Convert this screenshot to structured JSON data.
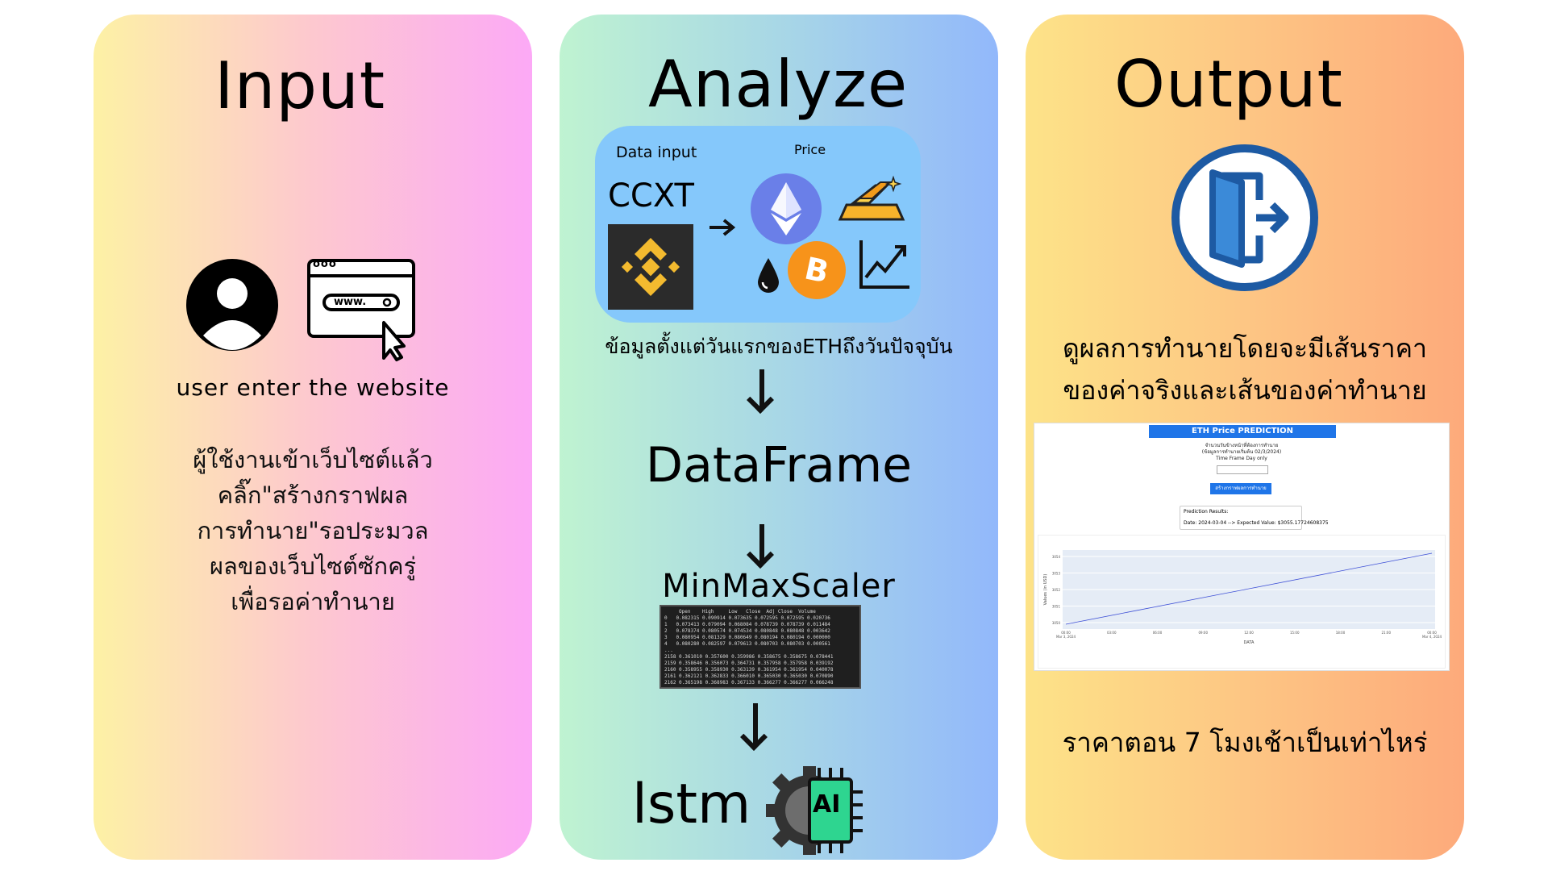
{
  "input": {
    "title": "Input",
    "caption": "user enter the website",
    "url_text": "www.",
    "browser_dots": "ooo",
    "thai_lines": [
      "ผู้ใช้งานเข้าเว็บไซต์แล้ว",
      "คลิ๊ก\"สร้างกราฟผล",
      "การทำนาย\"รอประมวล",
      "ผลของเว็บไซต์ซักครู่",
      "เพื่อรอค่าทำนาย"
    ]
  },
  "analyze": {
    "title": "Analyze",
    "data_input_label": "Data input",
    "price_label": "Price",
    "ccxt_label": "CCXT",
    "thai_caption": "ข้อมูลตั้งแต่วันแรกของETHถึงวันปัจจุบัน",
    "dataframe_label": "DataFrame",
    "scaler_label": "MinMaxScaler",
    "lstm_label": "lstm",
    "ai_label": "AI",
    "table_header": "     Open    High     Low   Close  Adj Close  Volume",
    "table_rows": [
      "0   0.082315 0.090914 0.073635 0.072595 0.072595 0.020736",
      "1   0.073413 0.079094 0.068084 0.078739 0.078739 0.011484",
      "2   0.078374 0.080574 0.074534 0.080848 0.080848 0.003642",
      "3   0.080954 0.081329 0.080649 0.080194 0.080194 0.000000",
      "4   0.080280 0.082597 0.079613 0.080703 0.080703 0.000561",
      "...",
      "2158 0.361010 0.357600 0.359986 0.358675 0.358675 0.078441",
      "2159 0.358646 0.356073 0.364731 0.357958 0.357958 0.039192",
      "2160 0.358955 0.358930 0.363139 0.361954 0.361954 0.040078",
      "2161 0.362121 0.362833 0.366010 0.365030 0.365030 0.070890",
      "2162 0.365198 0.368983 0.367133 0.366277 0.366277 0.066248"
    ]
  },
  "output": {
    "title": "Output",
    "thai_lines": [
      "ดูผลการทำนายโดยจะมีเส้นราคา",
      "ของค่าจริงและเส้นของค่าทำนาย"
    ],
    "bottom_thai": "ราคาตอน 7 โมงเช้าเป็นเท่าไหร่",
    "screenshot": {
      "header": "ETH Price PREDICTION",
      "line1": "จำนวนวันข้างหน้าที่ต้องการทำนาย",
      "line2": "(ข้อมูลการทำนายเริ่มต้น 02/3/2024)",
      "line3": "Time Frame Day only",
      "button": "สร้างกราฟผลการทำนาย",
      "result_title": "Prediction Results:",
      "result_text": "Date: 2024-03-04 --> Expected Value: $3055.17724608375",
      "y_ticks": [
        "3054",
        "3053",
        "3052",
        "3051",
        "3050"
      ],
      "x_ticks": [
        "00:00",
        "03:00",
        "06:00",
        "09:00",
        "12:00",
        "15:00",
        "18:00",
        "21:00",
        "00:00"
      ],
      "x_first_date": "Mar 3, 2024",
      "x_last_date": "Mar 4, 2024",
      "xlabel": "DATA",
      "ylabel": "Values (in USD)"
    }
  },
  "colors": {
    "binance_yellow": "#f3ba2f",
    "eth_blue": "#6a7fe8",
    "btc_orange": "#f7931a",
    "exit_blue": "#1d5aa3",
    "ai_green": "#2ed590"
  }
}
